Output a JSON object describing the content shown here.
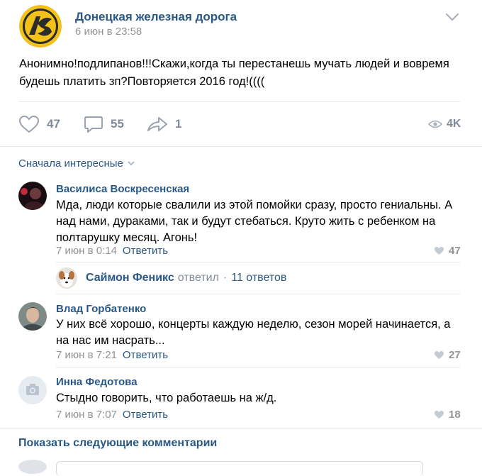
{
  "post": {
    "group_name": "Донецкая железная дорога",
    "date": "6 июн в 23:58",
    "text_line1": "Анонимно!подлипанов!!!Скажи,когда ты перестанешь мучать людей и вовремя",
    "text_line2": "будешь платить зп?Повторяется 2016 год!((((",
    "likes": "47",
    "comments": "55",
    "shares": "1",
    "views": "4K"
  },
  "sort_label": "Сначала интересные",
  "comments": [
    {
      "author": "Василиса Воскресенская",
      "lines": [
        "Мда, люди которые свалили из этой помойки сразу, просто гениальны. А",
        "над нами, дураками, так и будут стебаться. Круто жить с ребенком на",
        "полтарушку месяц. Агонь!"
      ],
      "date": "7 июн в 0:14",
      "reply": "Ответить",
      "likes": "47"
    },
    {
      "author": "Влад Горбатенко",
      "lines": [
        "У них всё хорошо, концерты каждую неделю, сезон морей начинается, а",
        "на нас им насрать..."
      ],
      "date": "7 июн в 7:21",
      "reply": "Ответить",
      "likes": "27"
    },
    {
      "author": "Инна Федотова",
      "lines": [
        "Стыдно говорить, что работаешь на ж/д."
      ],
      "date": "7 июн в 7:07",
      "reply": "Ответить",
      "likes": "18"
    }
  ],
  "thread": {
    "author": "Саймон Феникс",
    "replied": "ответил",
    "dot": "·",
    "replies": "11 ответов"
  },
  "show_more": "Показать следующие комментарии",
  "icons": {
    "like": "heart-icon",
    "comment": "comment-icon",
    "share": "share-arrow-icon",
    "views": "eye-icon",
    "menu": "chevron-down-icon",
    "camera": "camera-icon"
  },
  "colors": {
    "link": "#2a5885",
    "muted": "#939393",
    "action": "#828a99",
    "logo_yellow": "#f3c21a"
  }
}
